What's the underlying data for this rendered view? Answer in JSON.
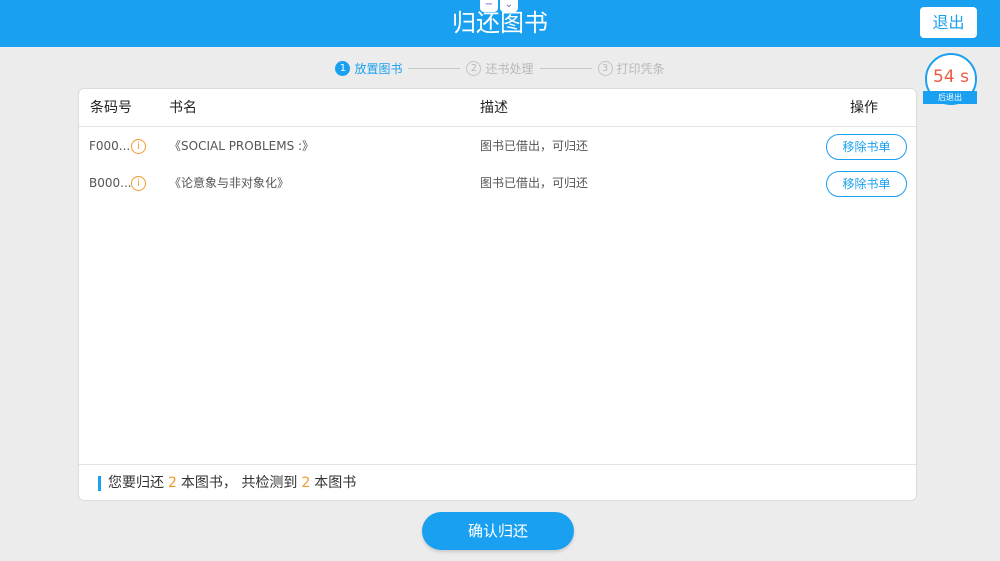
{
  "header": {
    "title": "归还图书",
    "exit_label": "退出",
    "minimize_symbol": "−",
    "collapse_symbol": "⌄"
  },
  "steps": [
    {
      "num": "1",
      "label": "放置图书",
      "active": true
    },
    {
      "num": "2",
      "label": "还书处理",
      "active": false
    },
    {
      "num": "3",
      "label": "打印凭条",
      "active": false
    }
  ],
  "timer": {
    "value": "54 s",
    "label": "后退出"
  },
  "table": {
    "columns": {
      "barcode": "条码号",
      "title": "书名",
      "description": "描述",
      "action": "操作"
    },
    "rows": [
      {
        "barcode": "F000...",
        "title": "《SOCIAL PROBLEMS :》",
        "description": "图书已借出，可归还",
        "action_label": "移除书单",
        "info_icon": "i"
      },
      {
        "barcode": "B000...",
        "title": "《论意象与非对象化》",
        "description": "图书已借出，可归还",
        "action_label": "移除书单",
        "info_icon": "i"
      }
    ]
  },
  "summary": {
    "prefix": "您要归还",
    "returning_count": "2",
    "middle": "本图书，  共检测到",
    "detected_count": "2",
    "suffix": "本图书"
  },
  "confirm_label": "确认归还",
  "colors": {
    "accent": "#1aa0f0",
    "warning": "#f39a2c",
    "timer": "#ee5a44"
  }
}
